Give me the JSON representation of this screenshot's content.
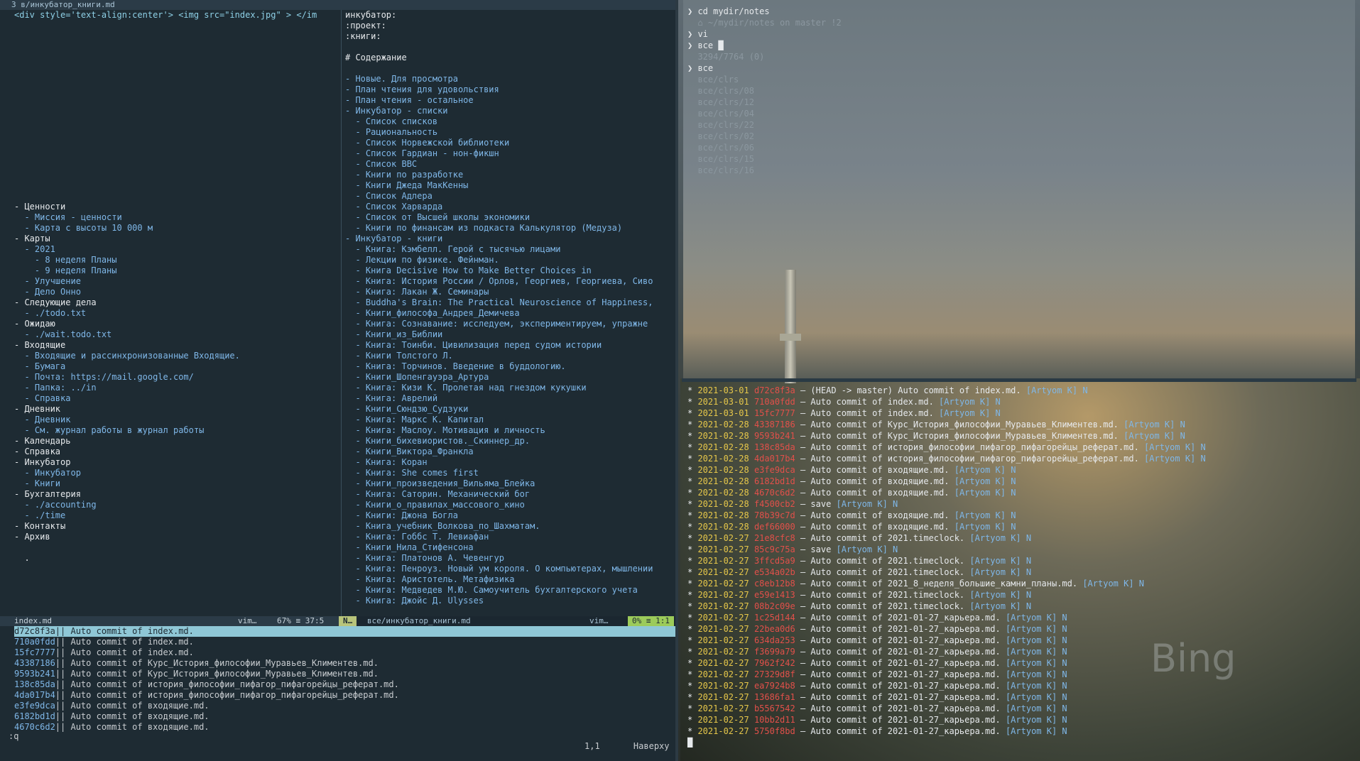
{
  "tab": {
    "label": "3 в/инкубатор_книги.md"
  },
  "left_window": {
    "lines": [
      "<div style='text-align:center'> <img src=\"index.jpg\" > </im",
      "",
      "",
      "",
      "",
      "",
      "",
      "",
      "",
      "",
      "",
      "",
      "",
      "",
      "",
      "",
      "",
      "",
      "- Ценности",
      "  - Миссия - ценности",
      "  - Карта с высоты 10 000 м",
      "- Карты",
      "  - 2021",
      "    - 8 неделя Планы",
      "    - 9 неделя Планы",
      "  - Улучшение",
      "  - Дело Онно",
      "- Следующие дела",
      "  - ./todo.txt",
      "- Ожидаю",
      "  - ./wait.todo.txt",
      "- Входящие",
      "  - Входящие и рассинхронизованные Входящие.",
      "  - Бумага",
      "  - Почта: https://mail.google.com/",
      "  - Папка: ../in",
      "  - Справка",
      "- Дневник",
      "  - Дневник",
      "  - См. журнал работы в журнал работы",
      "- Календарь",
      "- Справка",
      "- Инкубатор",
      "  - Инкубатор",
      "  - Книги",
      "- Бухгалтерия",
      "  - ./accounting",
      "  - ./time",
      "- Контакты",
      "- Архив",
      "",
      "  ."
    ]
  },
  "right_window": {
    "lines": [
      "инкубатор:",
      ":проект:",
      ":книги:",
      "",
      "# Содержание",
      "",
      "- Новые. Для просмотра",
      "- План чтения для удовольствия",
      "- План чтения - остальное",
      "- Инкубатор - списки",
      "  - Список списков",
      "  - Рациональность",
      "  - Список Норвежской библиотеки",
      "  - Список Гардиан - нон-фикшн",
      "  - Список BBC",
      "  - Книги по разработке",
      "  - Книги Джеда МакКенны",
      "  - Список Адлера",
      "  - Список Харварда",
      "  - Список от Высшей школы экономики",
      "  - Книги по финансам из подкаста Калькулятор (Медуза)",
      "- Инкубатор - книги",
      "  - Книга: Кэмбелл. Герой с тысячью лицами",
      "  - Лекции по физике. Фейнман.",
      "  - Книга Decisive How to Make Better Choices in",
      "  - Книга: История России / Орлов, Георгиев, Георгиева, Сиво",
      "  - Книга: Лакан Ж. Семинары",
      "  - Buddha's Brain: The Practical Neuroscience of Happiness,",
      "  - Книги_философа_Андрея_Демичева",
      "  - Книга: Сознавание: исследуем, экспериментируем, упражне",
      "  - Книги_из_Библии",
      "  - Книга: Тоинби. Цивилизация перед судом истории",
      "  - Книги Толстого Л.",
      "  - Книга: Торчинов. Введение в буддологию.",
      "  - Книги_Шопенгауэра_Артура",
      "  - Книга: Кизи К. Пролетая над гнездом кукушки",
      "  - Книга: Аврелий",
      "  - Книги_Сюндзю_Судзуки",
      "  - Книга: Маркс К. Капитал",
      "  - Книга: Маслоу. Мотивация и личность",
      "  - Книги_бихевиористов._Скиннер_др.",
      "  - Книги_Виктора_Франкла",
      "  - Книга: Коран",
      "  - Книга: She comes first",
      "  - Книги_произведения_Вильяма_Блейка",
      "  - Книга: Саторин. Механический бог",
      "  - Книги_о_правилах_массового_кино",
      "  - Книги: Джона Богла",
      "  - Книга_учебник_Волкова_по_Шахматам.",
      "  - Книга: Гоббс Т. Левиафан",
      "  - Книги_Нила_Стифенсона",
      "  - Книга: Платонов А. Чевенгур",
      "  - Книга: Пенроуз. Новый ум короля. О компьютерах, мышлении",
      "  - Книга: Аристотель. Метафизика",
      "  - Книга: Медведев М.Ю. Самоучитель бухгалтерского учета",
      "  - Книга: Джойс Д. Ulysses"
    ]
  },
  "status_left": {
    "file": "index.md",
    "type": "vim…",
    "pos": "67% ≡ 37:5"
  },
  "status_right": {
    "mode": "N…",
    "file": "все/инкубатор_книги.md",
    "type": "vim…",
    "pos": "0% ≡ 1:1"
  },
  "git_log_vim": [
    {
      "hash": "d72c8f3a",
      "msg": "|| Auto commit of index.md."
    },
    {
      "hash": "710a0fdd",
      "msg": "|| Auto commit of index.md."
    },
    {
      "hash": "15fc7777",
      "msg": "|| Auto commit of index.md."
    },
    {
      "hash": "43387186",
      "msg": "|| Auto commit of Курс_История_философии_Муравьев_Климентев.md."
    },
    {
      "hash": "9593b241",
      "msg": "|| Auto commit of Курс_История_философии_Муравьев_Климентев.md."
    },
    {
      "hash": "138c85da",
      "msg": "|| Auto commit of история_философии_пифагор_пифагорейцы_реферат.md."
    },
    {
      "hash": "4da017b4",
      "msg": "|| Auto commit of история_философии_пифагор_пифагорейцы_реферат.md."
    },
    {
      "hash": "e3fe9dca",
      "msg": "|| Auto commit of входящие.md."
    },
    {
      "hash": "6182bd1d",
      "msg": "|| Auto commit of входящие.md."
    },
    {
      "hash": "4670c6d2",
      "msg": "|| Auto commit of входящие.md."
    }
  ],
  "cmdline": ":q",
  "cursor_pos": {
    "pos": "1,1",
    "where": "Наверху"
  },
  "term_top": {
    "lines": [
      {
        "prompt": "❯",
        "text": "cd mydir/notes"
      },
      {
        "prompt": "",
        "text": "⌂ ~/mydir/notes on master !2"
      },
      {
        "prompt": "❯",
        "text": "vi"
      },
      {
        "prompt": "❯",
        "text": "все █"
      },
      {
        "prompt": "",
        "text": "3294/7764 (0)"
      },
      {
        "prompt": "❯",
        "text": "все"
      },
      {
        "prompt": "",
        "text": "все/clrs"
      },
      {
        "prompt": "",
        "text": "все/clrs/08"
      },
      {
        "prompt": "",
        "text": "все/clrs/12"
      },
      {
        "prompt": "",
        "text": "все/clrs/04"
      },
      {
        "prompt": "",
        "text": "все/clrs/22"
      },
      {
        "prompt": "",
        "text": "все/clrs/02"
      },
      {
        "prompt": "",
        "text": "все/clrs/06"
      },
      {
        "prompt": "",
        "text": "все/clrs/15"
      },
      {
        "prompt": "",
        "text": "все/clrs/16"
      }
    ]
  },
  "term_bottom": {
    "lines": [
      {
        "date": "2021-03-01",
        "hash": "d72c8f3a",
        "msg": "– (HEAD -> master) Auto commit of index.md.",
        "author": "[Artyom K] N"
      },
      {
        "date": "2021-03-01",
        "hash": "710a0fdd",
        "msg": "– Auto commit of index.md.",
        "author": "[Artyom K] N"
      },
      {
        "date": "2021-03-01",
        "hash": "15fc7777",
        "msg": "– Auto commit of index.md.",
        "author": "[Artyom K] N"
      },
      {
        "date": "2021-02-28",
        "hash": "43387186",
        "msg": "– Auto commit of Курс_История_философии_Муравьев_Климентев.md.",
        "author": "[Artyom K] N"
      },
      {
        "date": "2021-02-28",
        "hash": "9593b241",
        "msg": "– Auto commit of Курс_История_философии_Муравьев_Климентев.md.",
        "author": "[Artyom K] N"
      },
      {
        "date": "2021-02-28",
        "hash": "138c85da",
        "msg": "– Auto commit of история_философии_пифагор_пифагорейцы_реферат.md.",
        "author": "[Artyom K] N"
      },
      {
        "date": "2021-02-28",
        "hash": "4da017b4",
        "msg": "– Auto commit of история_философии_пифагор_пифагорейцы_реферат.md.",
        "author": "[Artyom K] N"
      },
      {
        "date": "2021-02-28",
        "hash": "e3fe9dca",
        "msg": "– Auto commit of входящие.md.",
        "author": "[Artyom K] N"
      },
      {
        "date": "2021-02-28",
        "hash": "6182bd1d",
        "msg": "– Auto commit of входящие.md.",
        "author": "[Artyom K] N"
      },
      {
        "date": "2021-02-28",
        "hash": "4670c6d2",
        "msg": "– Auto commit of входящие.md.",
        "author": "[Artyom K] N"
      },
      {
        "date": "2021-02-28",
        "hash": "f4500cb2",
        "msg": "– save",
        "author": "[Artyom K] N"
      },
      {
        "date": "2021-02-28",
        "hash": "78b39c7d",
        "msg": "– Auto commit of входящие.md.",
        "author": "[Artyom K] N"
      },
      {
        "date": "2021-02-28",
        "hash": "def66000",
        "msg": "– Auto commit of входящие.md.",
        "author": "[Artyom K] N"
      },
      {
        "date": "2021-02-27",
        "hash": "21e8cfc8",
        "msg": "– Auto commit of 2021.timeclock.",
        "author": "[Artyom K] N"
      },
      {
        "date": "2021-02-27",
        "hash": "85c9c75a",
        "msg": "– save",
        "author": "[Artyom K] N"
      },
      {
        "date": "2021-02-27",
        "hash": "3ffcd5a9",
        "msg": "– Auto commit of 2021.timeclock.",
        "author": "[Artyom K] N"
      },
      {
        "date": "2021-02-27",
        "hash": "e534a02b",
        "msg": "– Auto commit of 2021.timeclock.",
        "author": "[Artyom K] N"
      },
      {
        "date": "2021-02-27",
        "hash": "c8eb12b8",
        "msg": "– Auto commit of 2021_8_неделя_большие_камни_планы.md.",
        "author": "[Artyom K] N"
      },
      {
        "date": "2021-02-27",
        "hash": "e59e1413",
        "msg": "– Auto commit of 2021.timeclock.",
        "author": "[Artyom K] N"
      },
      {
        "date": "2021-02-27",
        "hash": "08b2c09e",
        "msg": "– Auto commit of 2021.timeclock.",
        "author": "[Artyom K] N"
      },
      {
        "date": "2021-02-27",
        "hash": "1c25d144",
        "msg": "– Auto commit of 2021-01-27_карьера.md.",
        "author": "[Artyom K] N"
      },
      {
        "date": "2021-02-27",
        "hash": "22bea0d6",
        "msg": "– Auto commit of 2021-01-27_карьера.md.",
        "author": "[Artyom K] N"
      },
      {
        "date": "2021-02-27",
        "hash": "634da253",
        "msg": "– Auto commit of 2021-01-27_карьера.md.",
        "author": "[Artyom K] N"
      },
      {
        "date": "2021-02-27",
        "hash": "f3699a79",
        "msg": "– Auto commit of 2021-01-27_карьера.md.",
        "author": "[Artyom K] N"
      },
      {
        "date": "2021-02-27",
        "hash": "7962f242",
        "msg": "– Auto commit of 2021-01-27_карьера.md.",
        "author": "[Artyom K] N"
      },
      {
        "date": "2021-02-27",
        "hash": "27329d8f",
        "msg": "– Auto commit of 2021-01-27_карьера.md.",
        "author": "[Artyom K] N"
      },
      {
        "date": "2021-02-27",
        "hash": "ea7924b8",
        "msg": "– Auto commit of 2021-01-27_карьера.md.",
        "author": "[Artyom K] N"
      },
      {
        "date": "2021-02-27",
        "hash": "13686fa1",
        "msg": "– Auto commit of 2021-01-27_карьера.md.",
        "author": "[Artyom K] N"
      },
      {
        "date": "2021-02-27",
        "hash": "b5567542",
        "msg": "– Auto commit of 2021-01-27_карьера.md.",
        "author": "[Artyom K] N"
      },
      {
        "date": "2021-02-27",
        "hash": "10bb2d11",
        "msg": "– Auto commit of 2021-01-27_карьера.md.",
        "author": "[Artyom K] N"
      },
      {
        "date": "2021-02-27",
        "hash": "5750f8bd",
        "msg": "– Auto commit of 2021-01-27_карьера.md.",
        "author": "[Artyom K] N"
      }
    ],
    "cursor": "█"
  },
  "watermark": "Bing",
  "colors": {
    "vim_bg": "#1e2b33",
    "hash_red": "#e2504a",
    "date_yellow": "#e6c74a",
    "link_blue": "#7fb7e8",
    "highlight": "#8fc7d6"
  }
}
